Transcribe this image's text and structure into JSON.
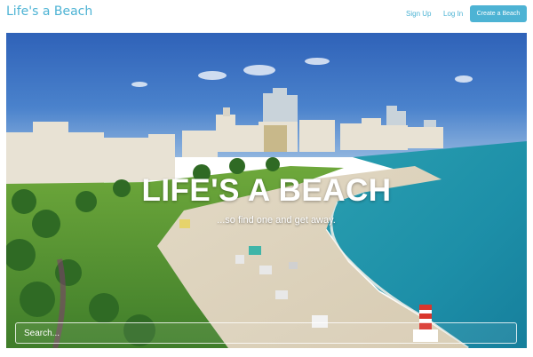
{
  "nav": {
    "brand": "Life's a Beach",
    "signup": "Sign Up",
    "login": "Log In",
    "create": "Create a Beach",
    "accent_color": "#4db3d4"
  },
  "hero": {
    "title": "LIFE'S A BEACH",
    "subtitle": "...so find one and get away.",
    "image_description_icon": "beach-city-aerial-photo"
  },
  "search": {
    "placeholder": "Search...",
    "value": ""
  }
}
